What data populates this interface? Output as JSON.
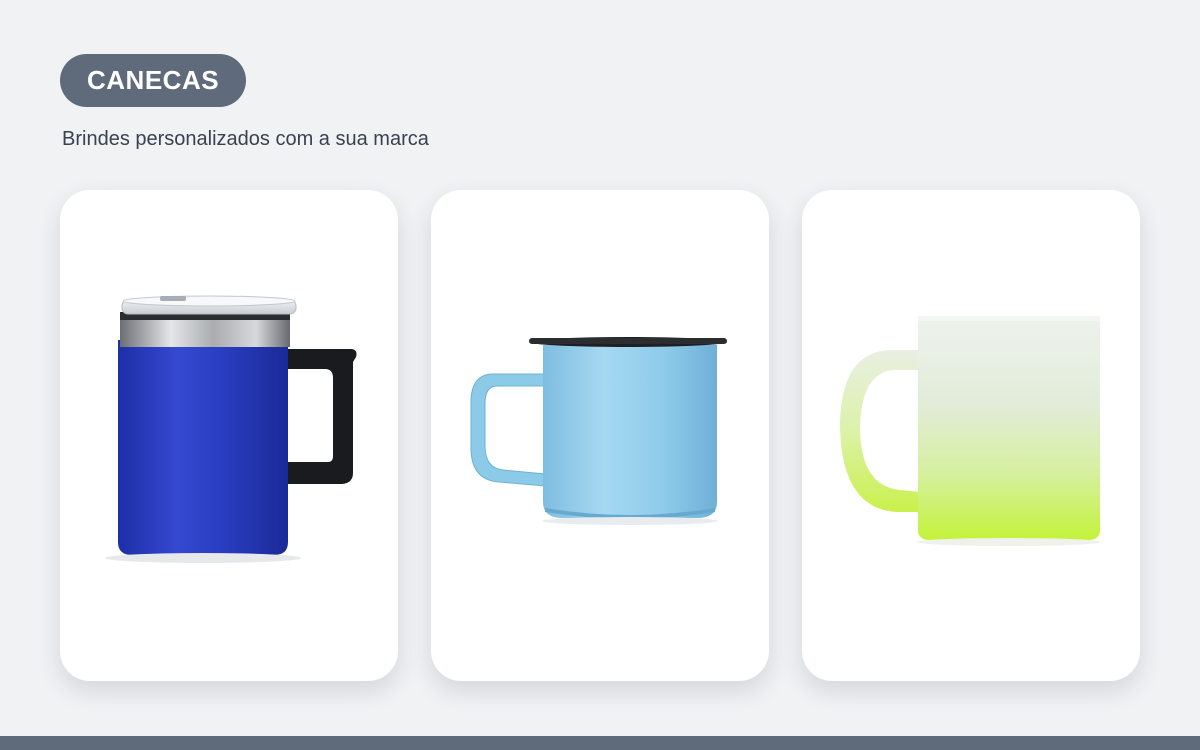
{
  "section": {
    "badge": "CANECAS",
    "subtitle": "Brindes personalizados com a sua marca"
  },
  "products": [
    {
      "image": "blue-steel-travel-mug-with-lid",
      "color": "#2a3fc4"
    },
    {
      "image": "light-blue-enamel-mug",
      "color": "#8dcbe9"
    },
    {
      "image": "frosted-glass-mug-lime-gradient",
      "color": "#c3f23a"
    }
  ],
  "colors": {
    "page_background": "#f0f2f4",
    "badge_background": "#5f6b7b",
    "footer_bar": "#5f6b7b"
  }
}
